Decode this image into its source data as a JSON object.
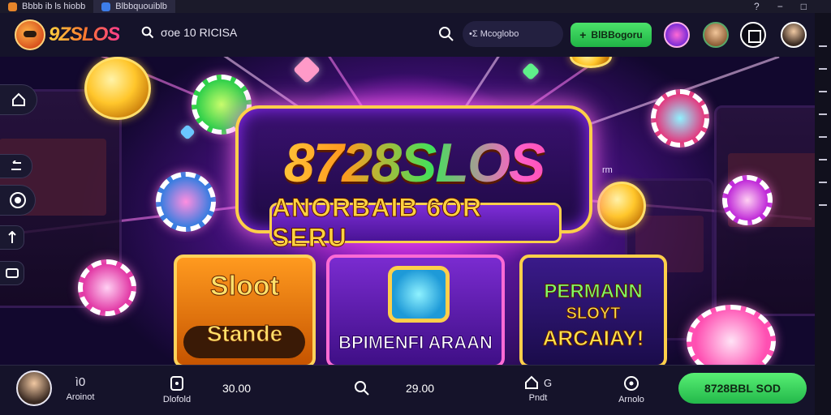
{
  "window": {
    "tabs": [
      {
        "label": "Bbbb ib ls  hiobb",
        "icon": "orange-app-icon"
      },
      {
        "label": "Blbbquouiblb",
        "icon": "blue-app-icon"
      }
    ],
    "controls": [
      "?",
      "−",
      "□"
    ]
  },
  "header": {
    "logo_text": "9ZSLOS",
    "search_left_label": "σοe 10 RICISA",
    "search_right_placeholder": "•Σ Mcoglobo",
    "promo_button_label": "BlBBogoru",
    "colors": {
      "accent_green": "#2fd157",
      "header_bg": "#15132a"
    }
  },
  "hero": {
    "title": "8728SLOS",
    "subtitle": "ANORBAIB 6OR SERU",
    "small_label": "rm",
    "cards": [
      {
        "line1": "Sloot",
        "line2": "Stande"
      },
      {
        "line1": "BPIMENFI ARAAN"
      },
      {
        "line1": "PERMANN",
        "line2": "SLOYT",
        "line3": "ARCAIAY!"
      }
    ]
  },
  "bottombar": {
    "items": [
      {
        "label": "Aroinot",
        "value": "ì0",
        "icon": "avatar"
      },
      {
        "label": "Dlofold",
        "value": "",
        "icon": "square-icon"
      },
      {
        "label": "",
        "value": "30.00",
        "icon": ""
      },
      {
        "label": "",
        "value": "29.00",
        "icon": "search-icon"
      },
      {
        "label": "Pndt",
        "value": "G",
        "icon": "home-icon"
      },
      {
        "label": "Arnolo",
        "value": "",
        "icon": "info-icon"
      }
    ],
    "cta_label": "8728BBL SOD"
  }
}
